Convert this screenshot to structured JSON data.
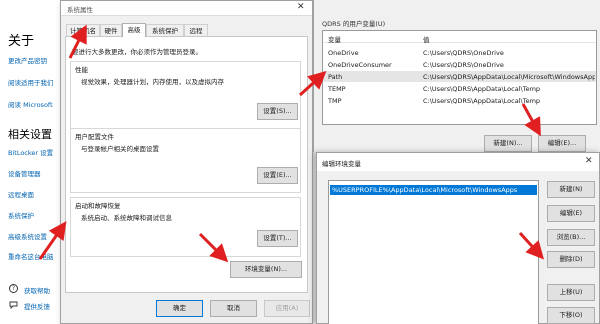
{
  "settings": {
    "about_title": "关于",
    "links": [
      "更改产品密钥",
      "阅读适用于我们",
      "阅读 Microsoft"
    ],
    "related_title": "相关设置",
    "related_links": [
      "BitLocker 设置",
      "设备管理器",
      "远程桌面",
      "系统保护",
      "高级系统设置",
      "重命名这台电脑"
    ],
    "help_links": [
      "获取帮助",
      "提供反馈"
    ]
  },
  "sysprop": {
    "title": "系统属性",
    "close_glyph": "✕",
    "tabs": [
      "计算机名",
      "硬件",
      "高级",
      "系统保护",
      "远程"
    ],
    "active_tab": 2,
    "admin_note": "要进行大多数更改，你必须作为管理员登录。",
    "performance": {
      "title": "性能",
      "desc": "视觉效果，处理器计划，内存使用，以及虚拟内存",
      "button": "设置(S)..."
    },
    "profile": {
      "title": "用户配置文件",
      "desc": "与登录帐户相关的桌面设置",
      "button": "设置(E)..."
    },
    "startup": {
      "title": "启动和故障恢复",
      "desc": "系统启动、系统故障和调试信息",
      "button": "设置(T)..."
    },
    "env_button": "环境变量(N)...",
    "ok": "确定",
    "cancel": "取消",
    "apply": "应用(A)"
  },
  "envvars": {
    "user_vars_label": "QDRS 的用户变量(U)",
    "col_var": "变量",
    "col_val": "值",
    "rows": [
      {
        "name": "OneDrive",
        "value": "C:\\Users\\QDRS\\OneDrive"
      },
      {
        "name": "OneDriveConsumer",
        "value": "C:\\Users\\QDRS\\OneDrive"
      },
      {
        "name": "Path",
        "value": "C:\\Users\\QDRS\\AppData\\Local\\Microsoft\\WindowsApps;"
      },
      {
        "name": "TEMP",
        "value": "C:\\Users\\QDRS\\AppData\\Local\\Temp"
      },
      {
        "name": "TMP",
        "value": "C:\\Users\\QDRS\\AppData\\Local\\Temp"
      }
    ],
    "selected_row": 2,
    "new_button": "新建(N)...",
    "edit_button": "编辑(E)...",
    "delete_button": "删除(D)"
  },
  "editdlg": {
    "title": "编辑环境变量",
    "close_glyph": "✕",
    "path_entry": "%USERPROFILE%\\AppData\\Local\\Microsoft\\WindowsApps",
    "buttons": [
      "新建(N)",
      "编辑(E)",
      "浏览(B)...",
      "删除(D)",
      "上移(U)",
      "下移(O)"
    ]
  },
  "colors": {
    "accent": "#0078d7",
    "link": "#0063b1",
    "arrow": "#e02020"
  }
}
